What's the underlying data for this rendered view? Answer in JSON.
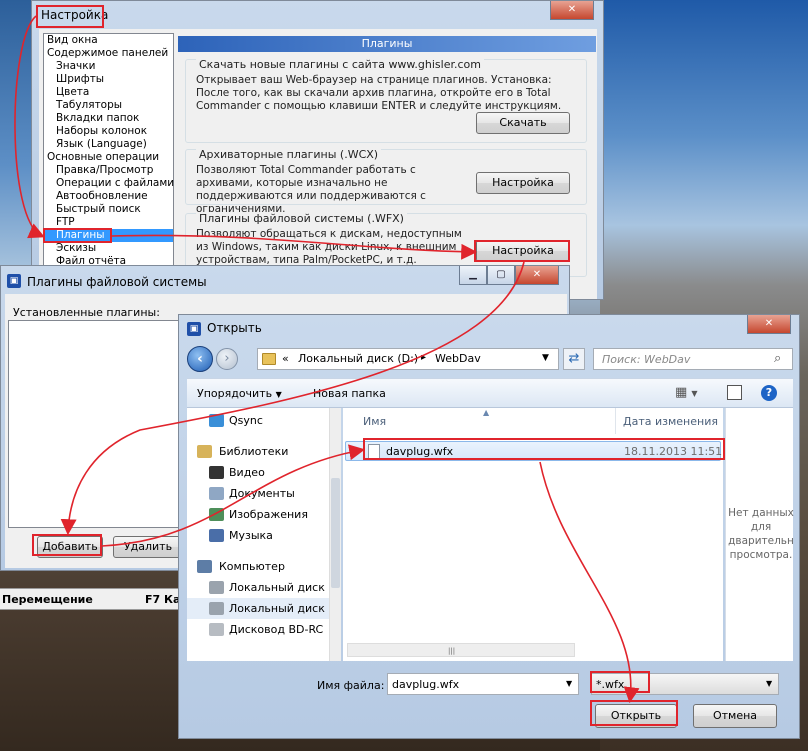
{
  "settings_window": {
    "title": "Настройка",
    "tree": [
      {
        "label": "Вид окна",
        "level": 0
      },
      {
        "label": "Содержимое панелей",
        "level": 0
      },
      {
        "label": "Значки",
        "level": 1
      },
      {
        "label": "Шрифты",
        "level": 1
      },
      {
        "label": "Цвета",
        "level": 1
      },
      {
        "label": "Табуляторы",
        "level": 1
      },
      {
        "label": "Вкладки папок",
        "level": 1
      },
      {
        "label": "Наборы колонок",
        "level": 1
      },
      {
        "label": "Язык (Language)",
        "level": 1
      },
      {
        "label": "Основные операции",
        "level": 0
      },
      {
        "label": "Правка/Просмотр",
        "level": 1
      },
      {
        "label": "Операции с файлами",
        "level": 1
      },
      {
        "label": "Автообновление",
        "level": 1
      },
      {
        "label": "Быстрый поиск",
        "level": 1
      },
      {
        "label": "FTP",
        "level": 1
      },
      {
        "label": "Плагины",
        "level": 1,
        "selected": true
      },
      {
        "label": "Эскизы",
        "level": 1
      },
      {
        "label": "Файл отчёта",
        "level": 1
      }
    ],
    "panel_header": "Плагины",
    "groups": [
      {
        "title": "Скачать новые плагины с сайта www.ghisler.com",
        "text": "Открывает ваш Web-браузер на странице плагинов. Установка: После того, как вы скачали архив плагина, откройте его в Total Commander с помощью клавиши ENTER и следуйте инструкциям.",
        "button": "Скачать"
      },
      {
        "title": "Архиваторные плагины (.WCX)",
        "text": "Позволяют Total Commander работать с архивами, которые изначально не поддерживаются или поддерживаются с ограничениями.",
        "button": "Настройка"
      },
      {
        "title": "Плагины файловой системы (.WFX)",
        "text": "Позволяют обращаться к дискам, недоступным из Windows, таким как диски Linux, к внешним устройствам, типа Palm/PocketPC, и т.д.",
        "button": "Настройка"
      }
    ]
  },
  "fs_plugins_window": {
    "title": "Плагины файловой системы",
    "installed_label": "Установленные плагины:",
    "add_button": "Добавить",
    "remove_button": "Удалить"
  },
  "tc_bar": {
    "move_label": "Перемещение",
    "f7_label": "F7 Ка"
  },
  "open_dialog": {
    "title": "Открыть",
    "breadcrumb": {
      "sep": "«",
      "drive": "Локальный диск (D:)",
      "folder": "WebDav"
    },
    "search_placeholder": "Поиск: WebDav",
    "toolbar": {
      "organize": "Упорядочить",
      "new_folder": "Новая папка"
    },
    "nav": [
      {
        "label": "Qsync",
        "icon": "qsync-icon",
        "type": "item"
      },
      {
        "label": "Библиотеки",
        "icon": "libraries-icon",
        "type": "header"
      },
      {
        "label": "Видео",
        "icon": "video-icon",
        "type": "item"
      },
      {
        "label": "Документы",
        "icon": "documents-icon",
        "type": "item"
      },
      {
        "label": "Изображения",
        "icon": "images-icon",
        "type": "item"
      },
      {
        "label": "Музыка",
        "icon": "music-icon",
        "type": "item"
      },
      {
        "label": "Компьютер",
        "icon": "computer-icon",
        "type": "header"
      },
      {
        "label": "Локальный диск",
        "icon": "drive-icon",
        "type": "item"
      },
      {
        "label": "Локальный диск",
        "icon": "drive-icon",
        "type": "item",
        "selected": true
      },
      {
        "label": "Дисковод BD-RC",
        "icon": "bd-drive-icon",
        "type": "item"
      }
    ],
    "columns": {
      "name": "Имя",
      "date": "Дата изменения"
    },
    "files": [
      {
        "name": "davplug.wfx",
        "date": "18.11.2013 11:51"
      }
    ],
    "preview_text": "Нет данных для дварительн просмотра.",
    "filename_label": "Имя файла:",
    "filename_value": "davplug.wfx",
    "filter_value": "*.wfx",
    "open_button": "Открыть",
    "cancel_button": "Отмена"
  },
  "colors": {
    "highlight": "#e0242c",
    "selection": "#3399ff"
  }
}
